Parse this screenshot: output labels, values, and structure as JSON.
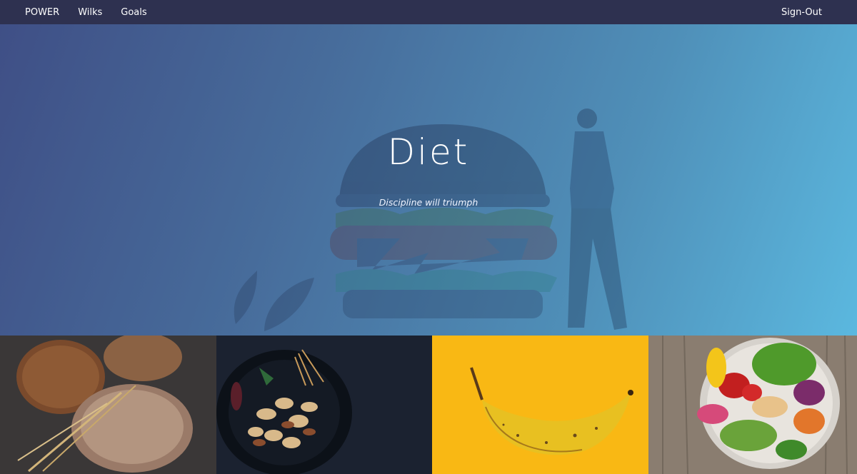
{
  "nav": {
    "brand": "POWER",
    "links": [
      {
        "label": "Wilks"
      },
      {
        "label": "Goals"
      }
    ],
    "signout": "Sign-Out"
  },
  "hero": {
    "title": "Diet",
    "subtitle": "Discipline will triumph"
  },
  "tiles": [
    {
      "name": "bread",
      "icon": "bread-photo"
    },
    {
      "name": "nuts",
      "icon": "nuts-bowl-photo"
    },
    {
      "name": "banana",
      "icon": "banana-photo"
    },
    {
      "name": "salad",
      "icon": "salad-bowl-photo"
    }
  ],
  "colors": {
    "nav_bg": "#2e3150",
    "hero_start": "#3f4f86",
    "hero_end": "#5bb8df",
    "banana_bg": "#f9b814"
  }
}
